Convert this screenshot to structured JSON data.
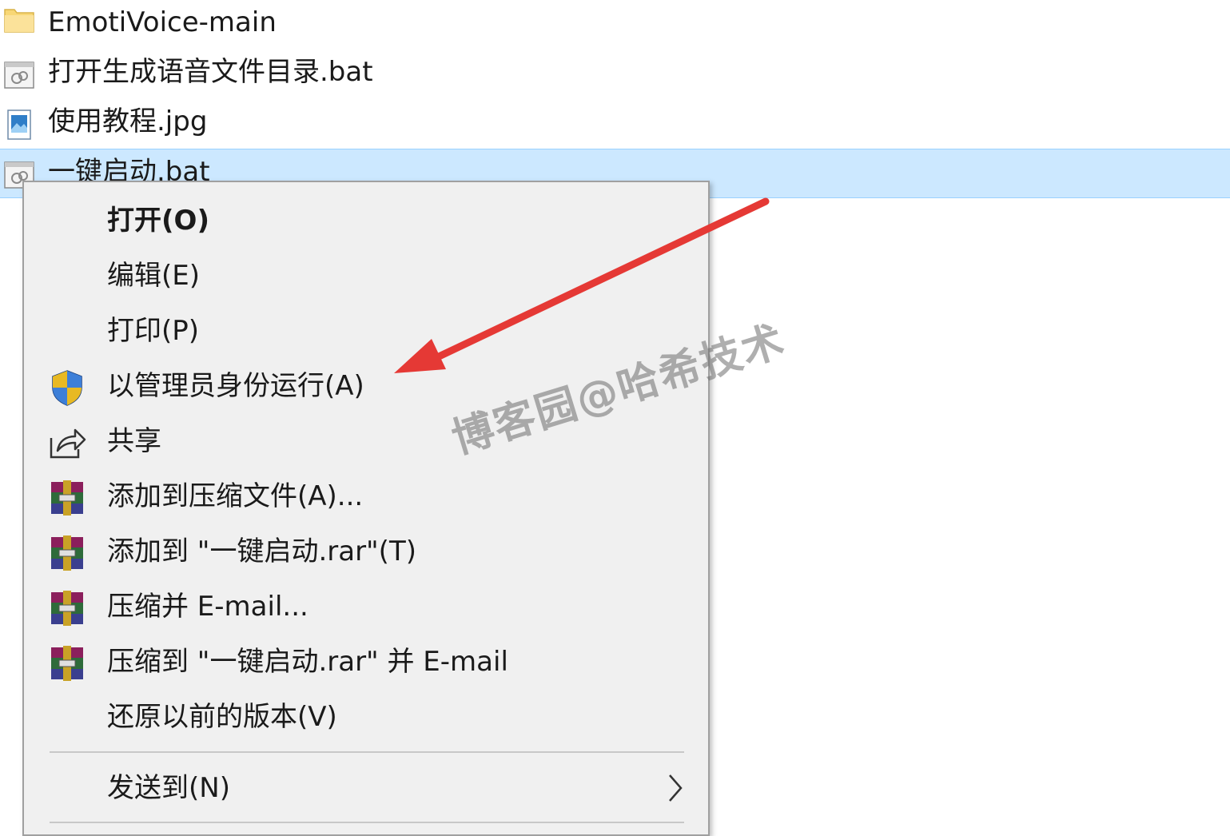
{
  "files": [
    {
      "name": "EmotiVoice-main",
      "icon": "folder-icon",
      "selected": false
    },
    {
      "name": "打开生成语音文件目录.bat",
      "icon": "batch-file-icon",
      "selected": false
    },
    {
      "name": "使用教程.jpg",
      "icon": "image-file-icon",
      "selected": false
    },
    {
      "name": "一键启动.bat",
      "icon": "batch-file-icon",
      "selected": true
    }
  ],
  "context_menu": {
    "items": [
      {
        "label": "打开(O)",
        "icon": null,
        "bold": true
      },
      {
        "label": "编辑(E)",
        "icon": null
      },
      {
        "label": "打印(P)",
        "icon": null
      },
      {
        "label": "以管理员身份运行(A)",
        "icon": "uac-shield-icon"
      },
      {
        "label": "共享",
        "icon": "share-icon"
      },
      {
        "label": "添加到压缩文件(A)...",
        "icon": "winrar-icon"
      },
      {
        "label": "添加到 \"一键启动.rar\"(T)",
        "icon": "winrar-icon"
      },
      {
        "label": "压缩并 E-mail...",
        "icon": "winrar-icon"
      },
      {
        "label": "压缩到 \"一键启动.rar\" 并 E-mail",
        "icon": "winrar-icon"
      },
      {
        "label": "还原以前的版本(V)",
        "icon": null
      }
    ],
    "send_to": {
      "label": "发送到(N)",
      "icon": "chevron-right-icon"
    }
  },
  "watermark": "博客园@哈希技术",
  "colors": {
    "selection_bg": "#cce8ff",
    "menu_bg": "#f0f0f0",
    "annotation_arrow": "#e53935"
  }
}
